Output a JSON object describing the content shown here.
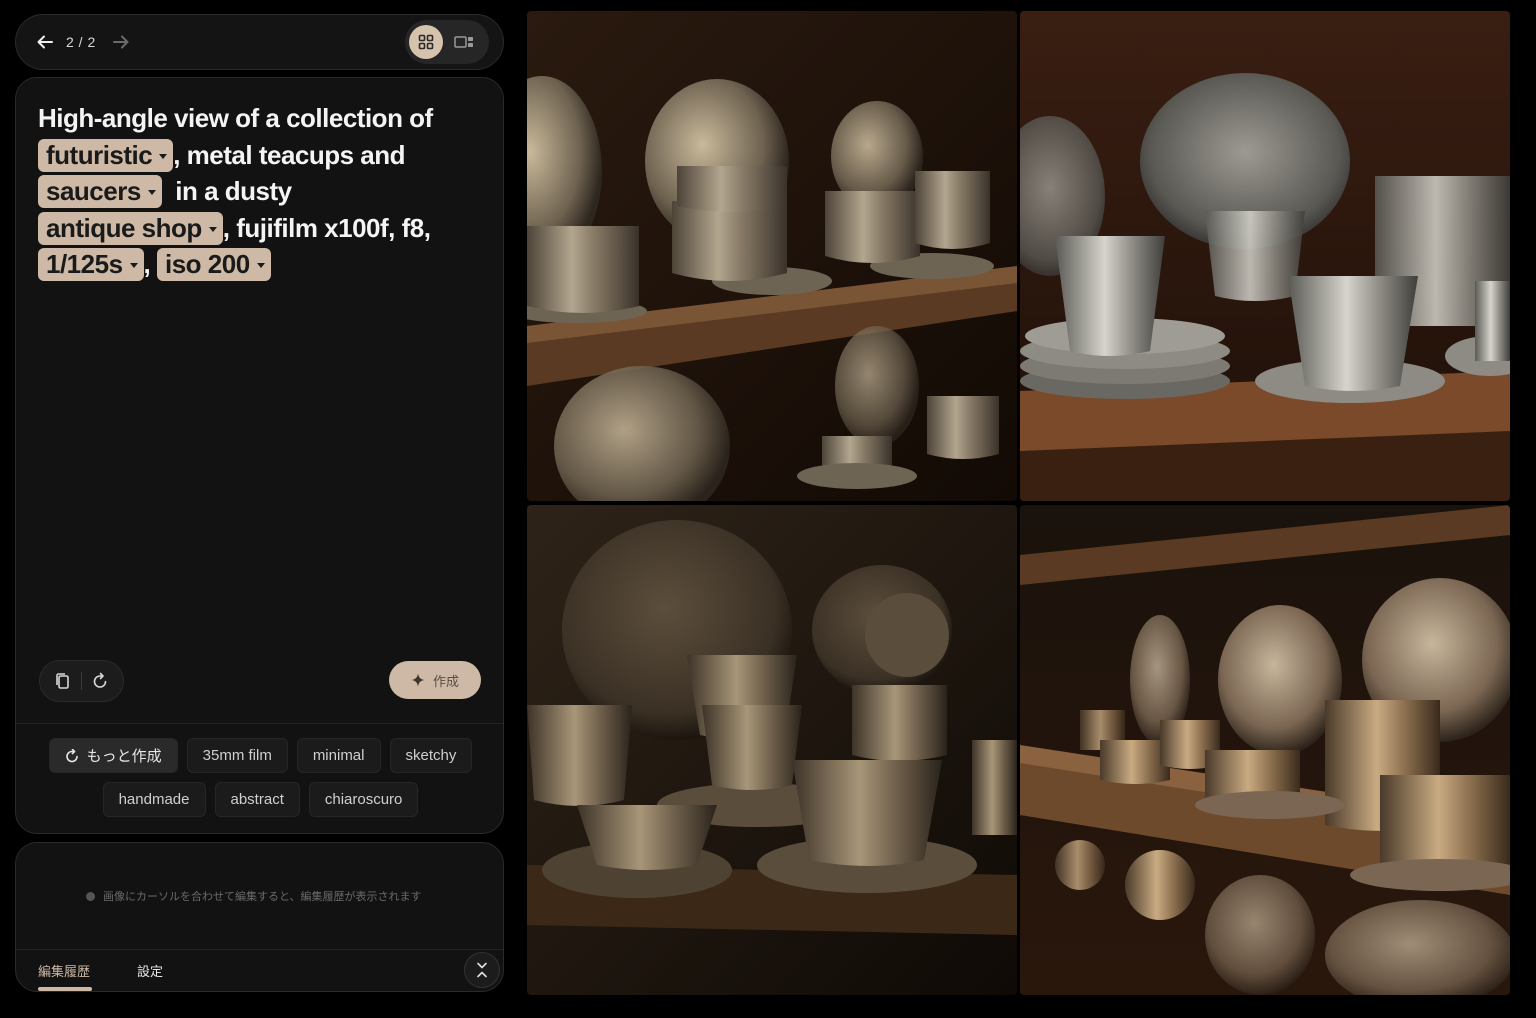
{
  "nav": {
    "counter": "2 / 2",
    "back_icon": "arrow-left-icon",
    "forward_icon": "arrow-right-icon",
    "grid_view_icon": "grid-icon",
    "single_view_icon": "single-view-icon"
  },
  "prompt": {
    "segments": [
      {
        "type": "text",
        "value": "High-angle view of a collection of "
      },
      {
        "type": "chip",
        "value": "futuristic"
      },
      {
        "type": "text",
        "value": ", metal teacups and "
      },
      {
        "type": "chip",
        "value": "saucers"
      },
      {
        "type": "text",
        "value": "  in a dusty "
      },
      {
        "type": "chip",
        "value": "antique shop"
      },
      {
        "type": "text",
        "value": ", fujifilm x100f, f8, "
      },
      {
        "type": "chip",
        "value": "1/125s"
      },
      {
        "type": "text",
        "value": ", "
      },
      {
        "type": "chip",
        "value": "iso 200"
      }
    ],
    "create_label": "作成",
    "copy_icon": "copy-icon",
    "reset_icon": "refresh-icon"
  },
  "suggestions": {
    "more_label": "もっと作成",
    "row1": [
      "35mm film",
      "minimal",
      "sketchy"
    ],
    "row2": [
      "handmade",
      "abstract",
      "chiaroscuro"
    ]
  },
  "history": {
    "hint": "画像にカーソルを合わせて編集すると、編集履歴が表示されます",
    "tab_history": "編集履歴",
    "tab_settings": "設定",
    "collapse_icon": "collapse-icon"
  },
  "colors": {
    "accent": "#cdb9a5",
    "panel": "#121212",
    "background": "#000000"
  }
}
